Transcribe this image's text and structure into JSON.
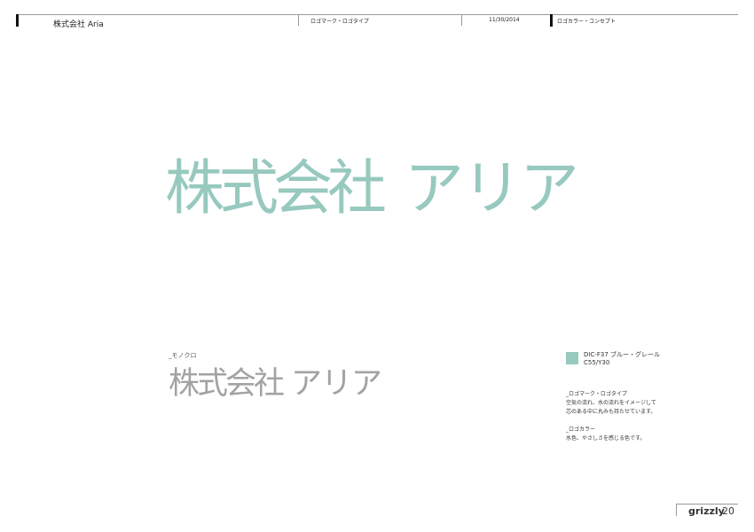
{
  "header": {
    "company": "株式会社 Aria",
    "section": "ロゴマーク・ロゴタイプ",
    "date": "11/30/2014",
    "subsection": "ロゴカラー・コンセプト"
  },
  "logo": {
    "kanji": "株式会社",
    "kana": "アリア"
  },
  "mono": {
    "label": "_モノクロ",
    "kanji": "株式会社",
    "kana": "アリア"
  },
  "color_spec": {
    "name": "DIC-F37 ブルー・グレール",
    "cmyk": "C55/Y30"
  },
  "notes": {
    "logotype_heading": "_ロゴマーク・ロゴタイプ",
    "logotype_line1": "空気の流れ、水の流れをイメージして",
    "logotype_line2": "芯のある中に丸みも持たせています。",
    "color_heading": "_ロゴカラー",
    "color_line1": "水色、やさしさを感じる色です。"
  },
  "footer": {
    "brand": "grizzly",
    "page": "20"
  },
  "colors": {
    "brand": "#97c9be",
    "mono": "#a3a3a3"
  }
}
